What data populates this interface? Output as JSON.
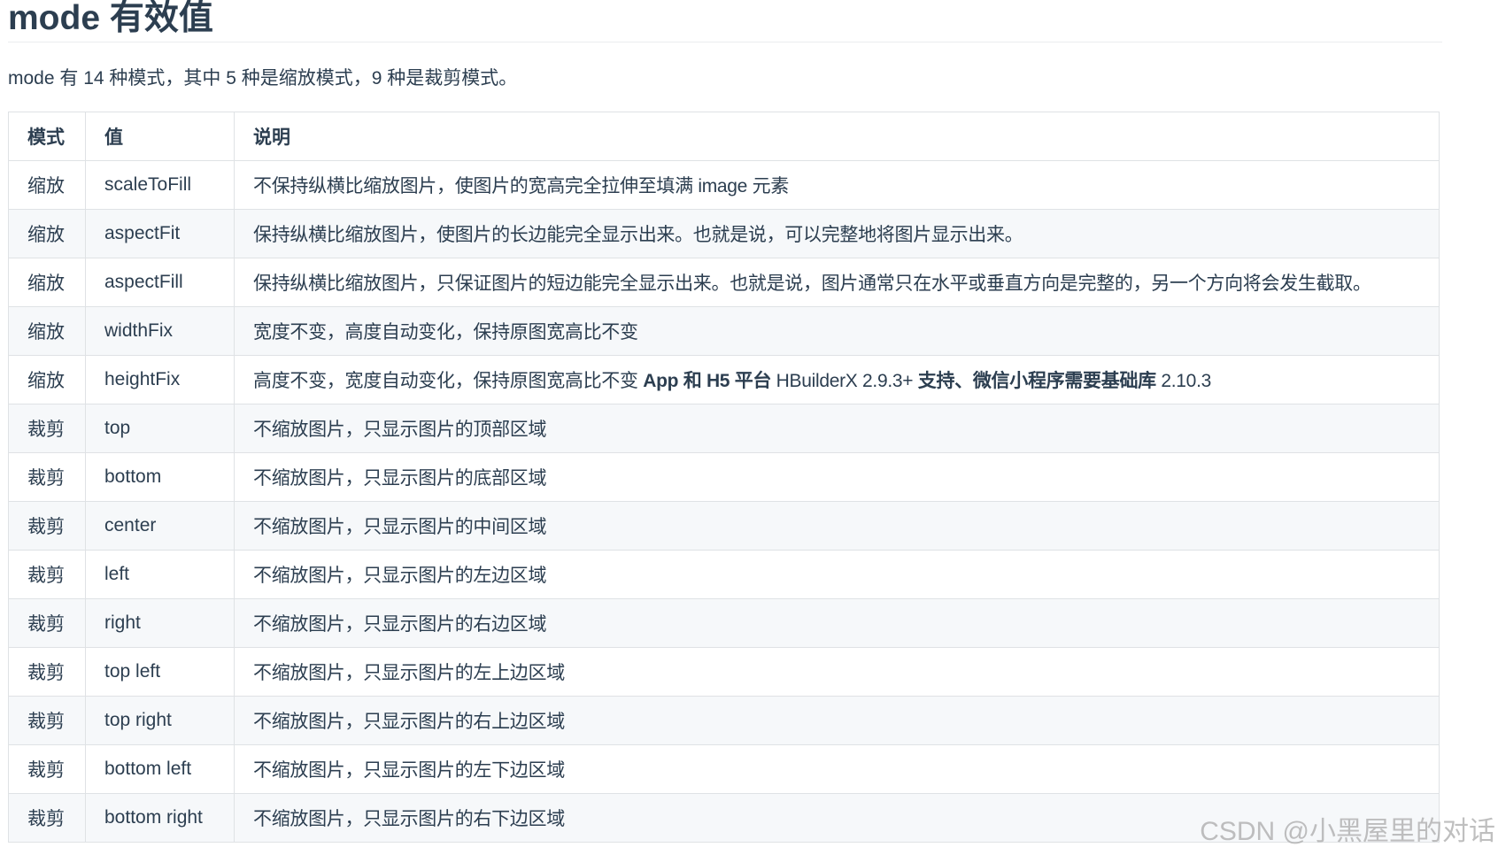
{
  "heading": "mode 有效值",
  "intro": "mode 有 14 种模式，其中 5 种是缩放模式，9 种是裁剪模式。",
  "table": {
    "headers": [
      "模式",
      "值",
      "说明"
    ],
    "rows": [
      {
        "mode": "缩放",
        "value": "scaleToFill",
        "desc": "不保持纵横比缩放图片，使图片的宽高完全拉伸至填满 image 元素"
      },
      {
        "mode": "缩放",
        "value": "aspectFit",
        "desc": "保持纵横比缩放图片，使图片的长边能完全显示出来。也就是说，可以完整地将图片显示出来。"
      },
      {
        "mode": "缩放",
        "value": "aspectFill",
        "desc": "保持纵横比缩放图片，只保证图片的短边能完全显示出来。也就是说，图片通常只在水平或垂直方向是完整的，另一个方向将会发生截取。"
      },
      {
        "mode": "缩放",
        "value": "widthFix",
        "desc": "宽度不变，高度自动变化，保持原图宽高比不变"
      },
      {
        "mode": "缩放",
        "value": "heightFix",
        "desc": "高度不变，宽度自动变化，保持原图宽高比不变",
        "desc_bold_1": "App 和 H5 平台",
        "desc_mid": " HBuilderX 2.9.3+ ",
        "desc_bold_2": "支持、微信小程序需要基础库",
        "desc_tail": " 2.10.3"
      },
      {
        "mode": "裁剪",
        "value": "top",
        "desc": "不缩放图片，只显示图片的顶部区域"
      },
      {
        "mode": "裁剪",
        "value": "bottom",
        "desc": "不缩放图片，只显示图片的底部区域"
      },
      {
        "mode": "裁剪",
        "value": "center",
        "desc": "不缩放图片，只显示图片的中间区域"
      },
      {
        "mode": "裁剪",
        "value": "left",
        "desc": "不缩放图片，只显示图片的左边区域"
      },
      {
        "mode": "裁剪",
        "value": "right",
        "desc": "不缩放图片，只显示图片的右边区域"
      },
      {
        "mode": "裁剪",
        "value": "top left",
        "desc": "不缩放图片，只显示图片的左上边区域"
      },
      {
        "mode": "裁剪",
        "value": "top right",
        "desc": "不缩放图片，只显示图片的右上边区域"
      },
      {
        "mode": "裁剪",
        "value": "bottom left",
        "desc": "不缩放图片，只显示图片的左下边区域"
      },
      {
        "mode": "裁剪",
        "value": "bottom right",
        "desc": "不缩放图片，只显示图片的右下边区域"
      }
    ]
  },
  "watermark": "CSDN @小黑屋里的对话"
}
